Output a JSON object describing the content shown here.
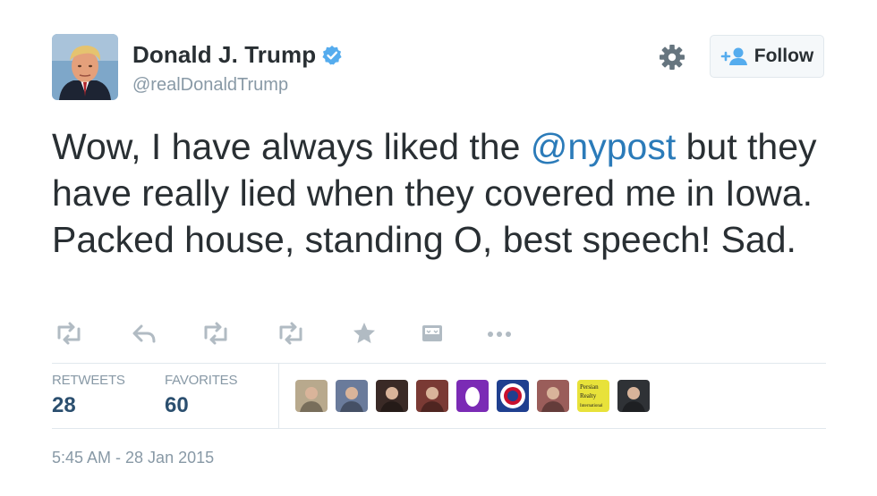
{
  "user": {
    "name": "Donald J. Trump",
    "handle": "@realDonaldTrump"
  },
  "follow": {
    "label": "Follow"
  },
  "tweet": {
    "segments": [
      {
        "text": "Wow, I have always liked the ",
        "mention": false
      },
      {
        "text": "@nypost",
        "mention": true
      },
      {
        "text": " but they have really lied when they covered me in Iowa. Packed house, standing O, best speech! Sad.",
        "mention": false
      }
    ]
  },
  "stats": {
    "retweets_label": "RETWEETS",
    "retweets_value": "28",
    "favorites_label": "FAVORITES",
    "favorites_value": "60"
  },
  "favoriter_avatars": [
    {
      "name": "avatar-1",
      "color": "#b8a98d"
    },
    {
      "name": "avatar-2",
      "color": "#6a7b9b"
    },
    {
      "name": "avatar-3",
      "color": "#3a2a26"
    },
    {
      "name": "avatar-4",
      "color": "#7a3a34"
    },
    {
      "name": "avatar-5",
      "color": "#7b2bb5"
    },
    {
      "name": "avatar-6",
      "color": "#1f3f8f"
    },
    {
      "name": "avatar-7",
      "color": "#9a5d5a"
    },
    {
      "name": "avatar-8",
      "color": "#e8e23a",
      "text": [
        "Persian",
        "Realty",
        "International"
      ]
    },
    {
      "name": "avatar-9",
      "color": "#2f3236"
    }
  ],
  "timestamp": "5:45 AM - 28 Jan 2015",
  "colors": {
    "text": "#292f33",
    "muted": "#8899a6",
    "link": "#2b7bb9",
    "verified": "#55acee",
    "border": "#e1e8ed"
  }
}
